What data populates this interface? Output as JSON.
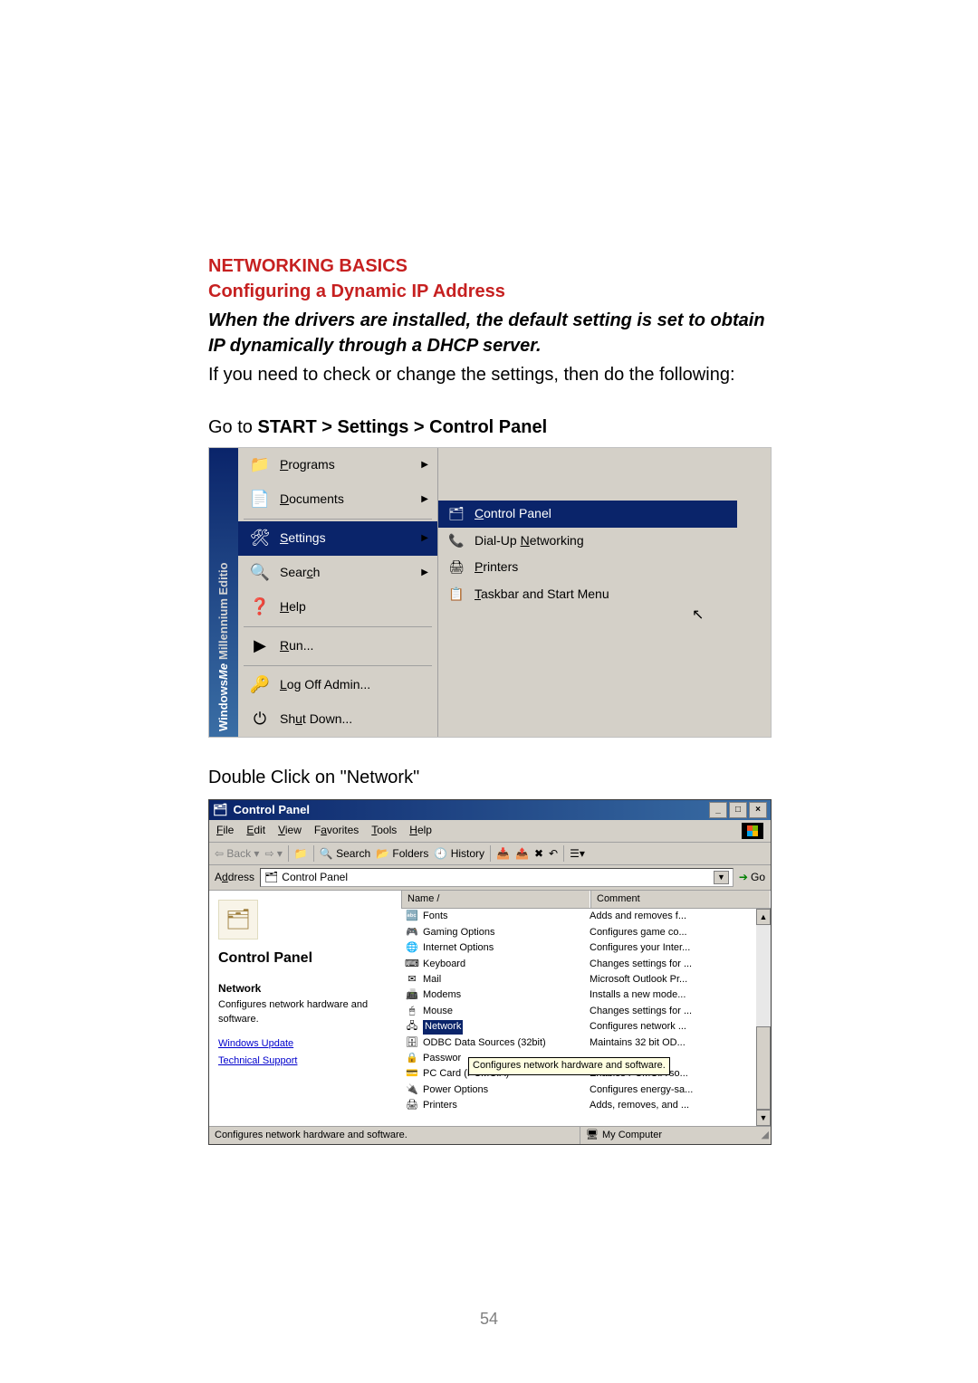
{
  "doc": {
    "heading": "NETWORKING BASICS",
    "subheading": "Configuring a Dynamic IP Address",
    "para1a": "When the drivers are installed, the default setting is set to obtain IP dynamically through a DHCP server.",
    "para1b": "If you need to check or change the settings, then do the following:",
    "step1_pre": "Go to ",
    "step1_bold": "START > Settings > Control Panel",
    "step2": "Double Click on \"Network\"",
    "pagenum": "54"
  },
  "startmenu": {
    "stripe_windows": "Windows",
    "stripe_me": "Me",
    "stripe_edition": "Millennium Editio",
    "items": [
      {
        "label": "Programs",
        "icon": "📁",
        "arrow": true
      },
      {
        "label": "Documents",
        "icon": "📄",
        "arrow": true
      },
      {
        "label": "Settings",
        "icon": "🛠",
        "arrow": true,
        "hl": true
      },
      {
        "label": "Search",
        "icon": "🔍",
        "arrow": true
      },
      {
        "label": "Help",
        "icon": "❓",
        "arrow": false
      },
      {
        "label": "Run...",
        "icon": "▶",
        "arrow": false
      },
      {
        "label": "Log Off Admin...",
        "icon": "🔑",
        "arrow": false
      },
      {
        "label": "Shut Down...",
        "icon": "⏻",
        "arrow": false
      }
    ],
    "submenu": [
      {
        "label": "Control Panel",
        "icon": "🗂",
        "hl": true
      },
      {
        "label": "Dial-Up Networking",
        "icon": "📞"
      },
      {
        "label": "Printers",
        "icon": "🖨"
      },
      {
        "label": "Taskbar and Start Menu",
        "icon": "📋"
      }
    ]
  },
  "cpwin": {
    "title": "Control Panel",
    "menus": [
      "File",
      "Edit",
      "View",
      "Favorites",
      "Tools",
      "Help"
    ],
    "toolbar": {
      "back": "Back",
      "search": "Search",
      "folders": "Folders",
      "history": "History"
    },
    "address_label": "Address",
    "address_value": "Control Panel",
    "go": "Go",
    "left": {
      "title": "Control Panel",
      "nettitle": "Network",
      "netdesc": "Configures network hardware and software.",
      "link1": "Windows Update",
      "link2": "Technical Support"
    },
    "cols": {
      "name": "Name  /",
      "comment": "Comment"
    },
    "rows": [
      {
        "icon": "🔤",
        "name": "Fonts",
        "comment": "Adds and removes f..."
      },
      {
        "icon": "🎮",
        "name": "Gaming Options",
        "comment": "Configures game co..."
      },
      {
        "icon": "🌐",
        "name": "Internet Options",
        "comment": "Configures your Inter..."
      },
      {
        "icon": "⌨",
        "name": "Keyboard",
        "comment": "Changes settings for ..."
      },
      {
        "icon": "✉",
        "name": "Mail",
        "comment": "Microsoft Outlook Pr..."
      },
      {
        "icon": "📠",
        "name": "Modems",
        "comment": "Installs a new mode..."
      },
      {
        "icon": "🖱",
        "name": "Mouse",
        "comment": "Changes settings for ..."
      },
      {
        "icon": "🖧",
        "name": "Network",
        "comment": "Configures network ...",
        "sel": true
      },
      {
        "icon": "🗄",
        "name": "ODBC Data Sources (32bit)",
        "comment": "Maintains 32 bit OD..."
      },
      {
        "icon": "🔒",
        "name": "Passwor",
        "comment": ""
      },
      {
        "icon": "💳",
        "name": "PC Card (PCMCIA)",
        "comment": "Enables PCMCIA so..."
      },
      {
        "icon": "🔌",
        "name": "Power Options",
        "comment": "Configures energy-sa..."
      },
      {
        "icon": "🖨",
        "name": "Printers",
        "comment": "Adds, removes, and ..."
      }
    ],
    "tooltip": "Configures network hardware and software.",
    "status_left": "Configures network hardware and software.",
    "status_right": "My Computer"
  }
}
